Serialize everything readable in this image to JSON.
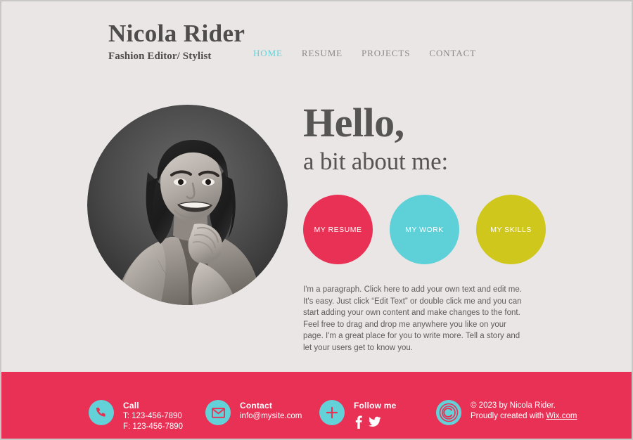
{
  "colors": {
    "page_background": "#eae6e5",
    "outer_border": "#c9c6c6",
    "footer_background": "#e93055",
    "accent_turquoise": "#63d2d8",
    "accent_pink": "#e93055",
    "accent_yellow": "#cfc71c",
    "text_dark": "#575454",
    "text_muted": "#8c8888"
  },
  "header": {
    "site_title": "Nicola Rider",
    "tagline": "Fashion Editor/ Stylist",
    "nav": [
      {
        "label": "HOME",
        "active": true
      },
      {
        "label": "RESUME",
        "active": false
      },
      {
        "label": "PROJECTS",
        "active": false
      },
      {
        "label": "CONTACT",
        "active": false
      }
    ]
  },
  "main": {
    "portrait_alt": "Black and white portrait photo of a smiling woman resting her chin on her hand",
    "hello_heading": "Hello,",
    "sub_heading": "a bit about me:",
    "circle_buttons": [
      {
        "label": "MY RESUME",
        "color": "#e93055"
      },
      {
        "label": "MY WORK",
        "color": "#5ed0d8"
      },
      {
        "label": "MY SKILLS",
        "color": "#cfc71c"
      }
    ],
    "paragraph": "I'm a paragraph. Click here to add your own text and edit me. It's easy. Just click “Edit Text” or double click me and you can start adding your own content and make changes to the font. Feel free to drag and drop me anywhere you like on your page. I'm a great place for you to write more. Tell a story and let your users get to know you."
  },
  "footer": {
    "call": {
      "icon": "phone-icon",
      "title": "Call",
      "line1": "T: 123-456-7890",
      "line2": "F: 123-456-7890"
    },
    "contact": {
      "icon": "envelope-icon",
      "title": "Contact",
      "line1": "info@mysite.com"
    },
    "follow": {
      "icon": "plus-icon",
      "title": "Follow me",
      "socials": [
        {
          "name": "facebook-icon"
        },
        {
          "name": "twitter-icon"
        }
      ]
    },
    "copyright": {
      "icon": "copyright-icon",
      "line1": "© 2023 by Nicola Rider.",
      "line2_prefix": "Proudly created with ",
      "line2_link": "Wix.com"
    }
  }
}
